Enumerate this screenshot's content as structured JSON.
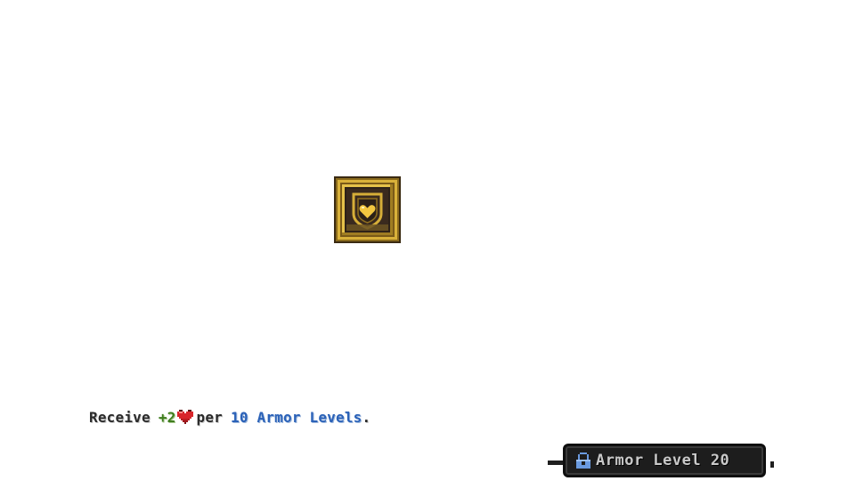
{
  "skill": {
    "icon": "gold-shield-heart-icon"
  },
  "description": {
    "prefix": "Receive",
    "bonus": "+2",
    "heart_icon": "heart-icon",
    "middle": "per",
    "levels": "10 Armor Levels",
    "suffix": ".",
    "colors": {
      "text": "#2a2a2a",
      "bonus": "#3f7d1e",
      "levels": "#2b62b8",
      "heart": "#d8252b"
    }
  },
  "requirement": {
    "icon": "lock-icon",
    "label": "Armor Level 20",
    "lock_color": "#6a9ae0"
  }
}
